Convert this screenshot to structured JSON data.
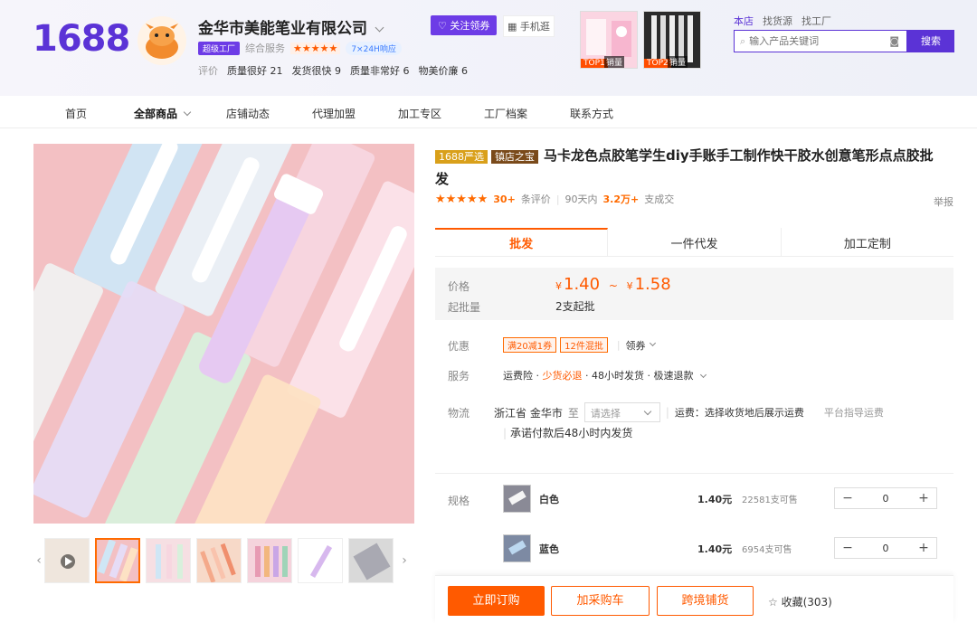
{
  "header": {
    "logo": "1688",
    "company": "金华市美能笔业有限公司",
    "super_badge": "超级工厂",
    "overall_service_label": "综合服务",
    "stars": "★★★★★",
    "service_badge": "7×24H响应",
    "follow_label": "关注领券",
    "phone_label": "手机逛",
    "evals": {
      "label": "评价",
      "items": [
        "质量很好 21",
        "发货很快 9",
        "质量非常好 6",
        "物美价廉 6"
      ]
    },
    "promos": [
      {
        "rank": "TOP1",
        "caption": "销量"
      },
      {
        "rank": "TOP2",
        "caption": "销量"
      }
    ],
    "search_tabs": [
      "本店",
      "找货源",
      "找工厂"
    ],
    "search_placeholder": "输入产品关键词",
    "search_button": "搜索"
  },
  "nav": [
    "首页",
    "全部商品",
    "店铺动态",
    "代理加盟",
    "加工专区",
    "工厂档案",
    "联系方式"
  ],
  "product": {
    "tag_yx": "1688严选",
    "tag_zb": "镇店之宝",
    "title": "马卡龙色点胶笔学生diy手账手工制作快干胶水创意笔形点点胶批发",
    "rating_stars": "★★★★★",
    "review_count": "30+",
    "review_unit": "条评价",
    "sales_label": "90天内",
    "sales_value": "3.2万+",
    "sales_unit": "支成交",
    "report": "举报",
    "tabs": [
      "批发",
      "一件代发",
      "加工定制"
    ],
    "price_label": "价格",
    "price_currency": "¥",
    "price_min": "1.40",
    "price_sep": "~",
    "price_max": "1.58",
    "moq_label": "起批量",
    "moq_value": "2支起批",
    "promo_label": "优惠",
    "promo_tags": [
      "满20减1券",
      "12件混批"
    ],
    "promo_more": "领券",
    "service_label": "服务",
    "service_items": [
      "运费险",
      "少货必退",
      "48小时发货",
      "极速退款"
    ],
    "logistics_label": "物流",
    "logistics_from": "浙江省 金华市",
    "logistics_to": "至",
    "logistics_select": "请选择",
    "logistics_fee": "运费：选择收货地后展示运费",
    "logistics_platform": "平台指导运费",
    "logistics_promise": "承诺付款后48小时内发货",
    "spec_label": "规格",
    "specs": [
      {
        "name": "白色",
        "price": "1.40元",
        "stock": "22581支可售",
        "qty": "0"
      },
      {
        "name": "蓝色",
        "price": "1.40元",
        "stock": "6954支可售",
        "qty": "0"
      }
    ],
    "buy_label": "立即订购",
    "cart_label": "加采购车",
    "cross_label": "跨境铺货",
    "fav_label": "收藏(303)"
  }
}
